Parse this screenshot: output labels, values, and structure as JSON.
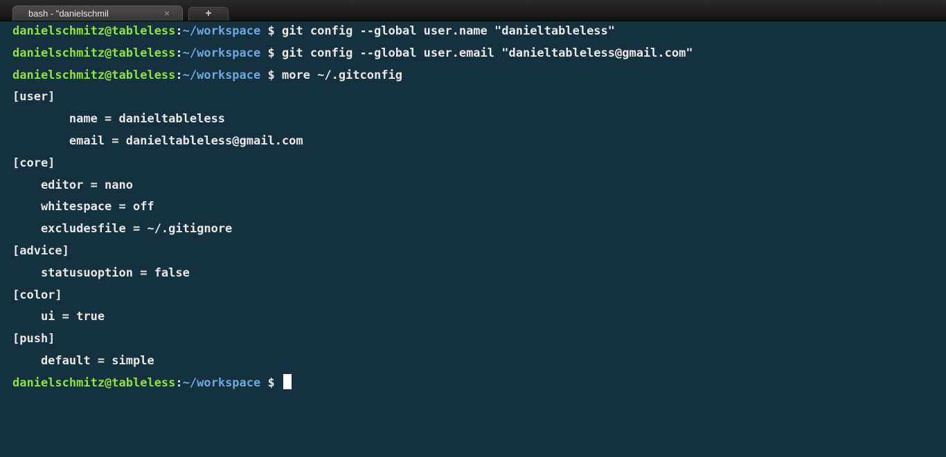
{
  "tabs": [
    {
      "title": "bash - \"danielschmil",
      "close_glyph": "×",
      "active": true
    }
  ],
  "new_tab_glyph": "+",
  "prompt": {
    "user_host": "danielschmitz@tableless",
    "separator": ":",
    "path": "~/workspace",
    "symbol": " $ "
  },
  "commands": [
    "git config --global user.name \"danieltableless\"",
    "git config --global user.email \"danieltableless@gmail.com\"",
    "more ~/.gitconfig"
  ],
  "output": [
    "[user]",
    "        name = danieltableless",
    "        email = danieltableless@gmail.com",
    "[core]",
    "    editor = nano",
    "    whitespace = off",
    "    excludesfile = ~/.gitignore",
    "[advice]",
    "    statusuoption = false",
    "[color]",
    "    ui = true",
    "[push]",
    "    default = simple"
  ],
  "colors": {
    "background": "#15303f",
    "prompt_user": "#8ee33a",
    "prompt_path": "#6fa8dc",
    "text": "#e8e8e8"
  }
}
